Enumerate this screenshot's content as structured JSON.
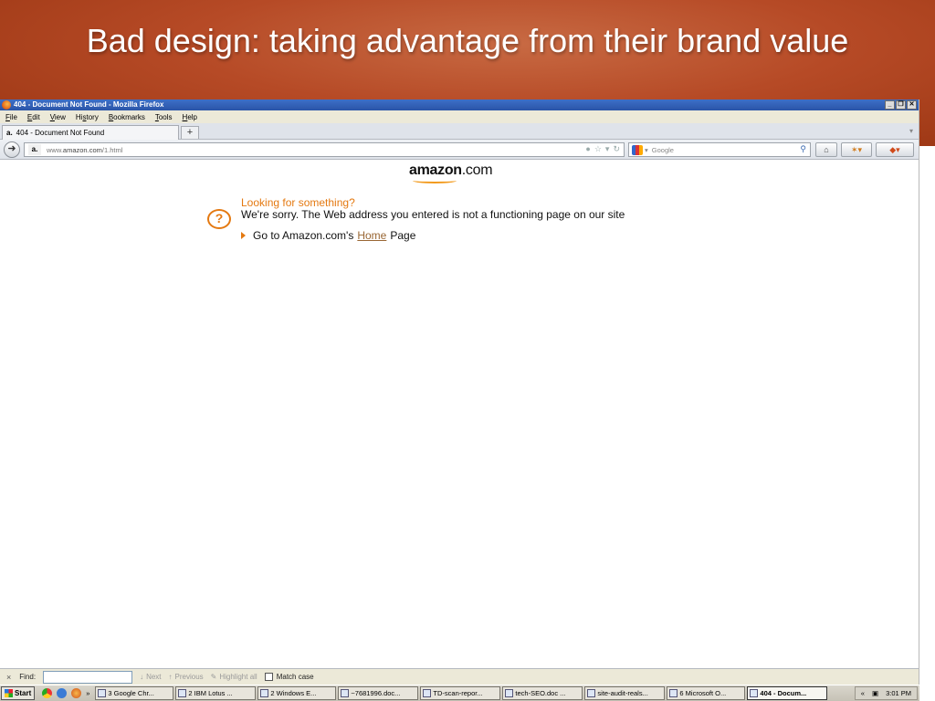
{
  "slide": {
    "title": "Bad design: taking advantage from their brand value"
  },
  "browser": {
    "window_title": "404 - Document Not Found - Mozilla Firefox",
    "window_buttons": [
      "_",
      "❐",
      "✕"
    ],
    "menu": [
      {
        "accel": "F",
        "rest": "ile"
      },
      {
        "accel": "E",
        "rest": "dit"
      },
      {
        "accel": "V",
        "rest": "iew"
      },
      {
        "pre": "Hi",
        "accel": "s",
        "rest": "tory"
      },
      {
        "accel": "B",
        "rest": "ookmarks"
      },
      {
        "accel": "T",
        "rest": "ools"
      },
      {
        "accel": "H",
        "rest": "elp"
      }
    ],
    "tab": {
      "favicon": "a.",
      "label": "404 - Document Not Found",
      "new_tab": "+"
    },
    "url": {
      "favicon": "a.",
      "prefix": "www.",
      "host": "amazon.com",
      "path": "/1.html"
    },
    "search": {
      "engine_label": "▾",
      "placeholder": "Google"
    }
  },
  "page": {
    "logo_bold": "amazon",
    "logo_rest": ".com",
    "looking": "Looking for something?",
    "sorry": "We're sorry. The Web address you entered is not a functioning page on our site",
    "goto_prefix": "Go to Amazon.com's",
    "goto_link": "Home",
    "goto_suffix": "Page"
  },
  "findbar": {
    "close": "×",
    "label": "Find:",
    "next": "Next",
    "previous": "Previous",
    "highlight": "Highlight all",
    "match_case": "Match case"
  },
  "taskbar": {
    "start": "Start",
    "more": "»",
    "tasks": [
      {
        "label": "3 Google Chr...",
        "active": false
      },
      {
        "label": "2 IBM Lotus ...",
        "active": false
      },
      {
        "label": "2 Windows E...",
        "active": false
      },
      {
        "label": "~7681996.doc...",
        "active": false
      },
      {
        "label": "TD-scan-repor...",
        "active": false
      },
      {
        "label": "tech-SEO.doc ...",
        "active": false
      },
      {
        "label": "site-audit-reals...",
        "active": false
      },
      {
        "label": "6 Microsoft O...",
        "active": false
      },
      {
        "label": "404 - Docum...",
        "active": true
      }
    ],
    "tray_chevron": "«",
    "time": "3:01 PM"
  },
  "colors": {
    "slide_header": "#b64a26",
    "amazon_orange": "#e47911",
    "link_brown": "#996633",
    "titlebar_blue": "#2a55a8"
  }
}
